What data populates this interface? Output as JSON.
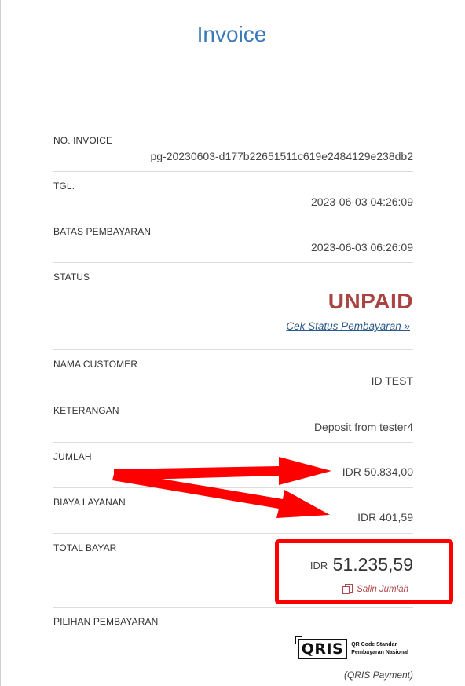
{
  "page": {
    "title": "Invoice"
  },
  "invoice": {
    "no_label": "NO. INVOICE",
    "no_value": "pg-20230603-d177b22651511c619e2484129e238db2",
    "tgl_label": "TGL.",
    "tgl_value": "2023-06-03 04:26:09",
    "batas_label": "BATAS PEMBAYARAN",
    "batas_value": "2023-06-03 06:26:09",
    "status_label": "STATUS",
    "status_value": "UNPAID",
    "status_link": "Cek Status Pembayaran »",
    "nama_label": "NAMA CUSTOMER",
    "nama_value": "ID TEST",
    "ket_label": "KETERANGAN",
    "ket_value": "Deposit from tester4",
    "jumlah_label": "JUMLAH",
    "jumlah_value": "IDR 50.834,00",
    "biaya_label": "BIAYA LAYANAN",
    "biaya_value": "IDR 401,59",
    "total_label": "TOTAL BAYAR",
    "total_currency": "IDR",
    "total_amount": "51.235,59",
    "copy_label": "Salin Jumlah",
    "pilihan_label": "PILIHAN PEMBAYARAN",
    "qris_mark": "QRIS",
    "qris_sub_line1": "QR Code Standar",
    "qris_sub_line2": "Pembayaran Nasional",
    "qris_caption": "(QRIS Payment)"
  },
  "colors": {
    "title": "#3b7ab8",
    "status_unpaid": "#a94442",
    "link": "#2d5a8c",
    "annotation": "#ff0000"
  }
}
